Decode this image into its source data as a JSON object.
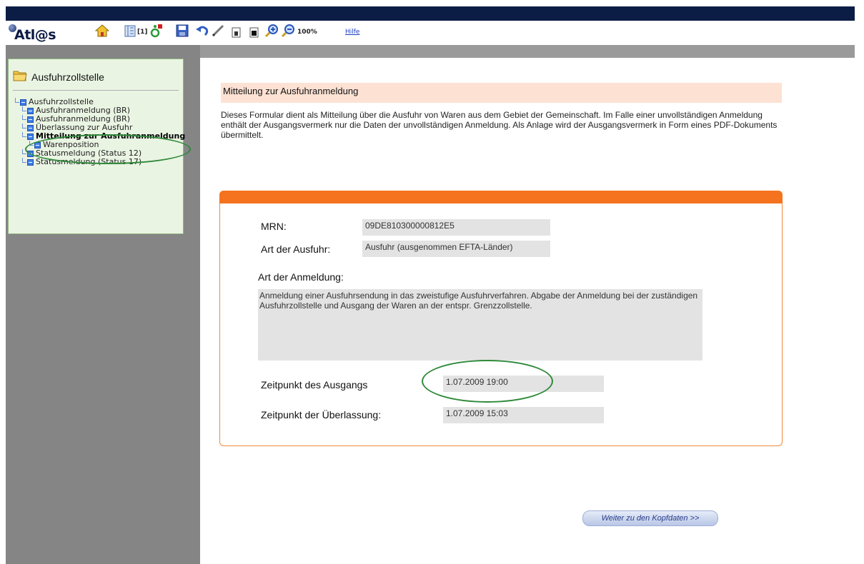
{
  "app": {
    "logo_text": "Atl@s"
  },
  "toolbar": {
    "icons": [
      "home-icon",
      "tree-icon",
      "wheelchair-icon",
      "save-icon",
      "undo-icon",
      "pen-icon",
      "page1-icon",
      "page2-icon",
      "zoom-in-icon",
      "zoom-out-icon"
    ],
    "bracket_label": "[1]",
    "zoom_label": "100%",
    "help_label": "Hilfe"
  },
  "sidebar": {
    "title": "Ausfuhrzollstelle",
    "items": [
      {
        "label": "Ausfuhrzollstelle",
        "level": 0,
        "bold": false
      },
      {
        "label": "Ausfuhranmeldung  (BR)",
        "level": 1,
        "bold": false
      },
      {
        "label": "Ausfuhranmeldung  (BR)",
        "level": 1,
        "bold": false
      },
      {
        "label": "Überlassung zur Ausfuhr",
        "level": 1,
        "bold": false
      },
      {
        "label": "Mitteilung zur Ausfuhranmeldung",
        "level": 1,
        "bold": true
      },
      {
        "label": "Warenposition",
        "level": 2,
        "bold": false
      },
      {
        "label": "Statusmeldung (Status 12)",
        "level": 1,
        "bold": false
      },
      {
        "label": "Statusmeldung (Status 17)",
        "level": 1,
        "bold": false
      }
    ]
  },
  "main": {
    "title": "Mitteilung zur Ausfuhranmeldung",
    "intro": "Dieses Formular dient als Mitteilung über die Ausfuhr von Waren aus dem Gebiet der Gemeinschaft.  Im Falle einer unvollständigen Anmeldung enthält der Ausgangsvermerk nur die Daten der unvollständigen Anmeldung. Als Anlage wird der Ausgangsvermerk in Form eines PDF-Dokuments übermittelt.",
    "fields": {
      "mrn_label": "MRN:",
      "mrn_value": "09DE810300000812E5",
      "art_ausfuhr_label": "Art der Ausfuhr:",
      "art_ausfuhr_value": "Ausfuhr (ausgenommen EFTA-Länder)",
      "art_anmeldung_label": "Art der Anmeldung:",
      "art_anmeldung_value": "Anmeldung einer Ausfuhrsendung in das zweistufige Ausfuhrverfahren. Abgabe der Anmeldung bei der zuständigen Ausfuhrzollstelle und Ausgang der Waren an der entspr. Grenzzollstelle.",
      "zeitpunkt_ausgang_label": "Zeitpunkt des Ausgangs",
      "zeitpunkt_ausgang_value": "1.07.2009 19:00",
      "zeitpunkt_ueberlassung_label": "Zeitpunkt der Überlassung:",
      "zeitpunkt_ueberlassung_value": "1.07.2009 15:03"
    },
    "next_button": "Weiter zu den Kopfdaten  >>"
  },
  "colors": {
    "topbar": "#0b1d45",
    "panel_header": "#f5731e",
    "title_bar": "#fde2d4",
    "sidebar_bg": "#eaf4e3",
    "highlight": "#2f8a3a"
  }
}
